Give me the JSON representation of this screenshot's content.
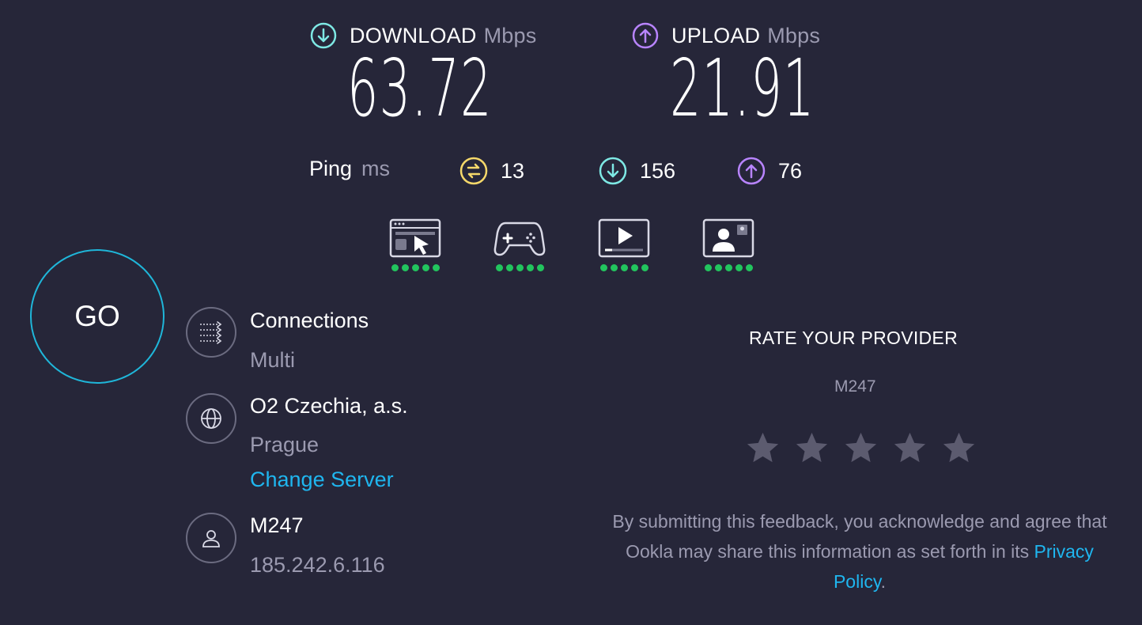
{
  "download": {
    "label": "DOWNLOAD",
    "unit": "Mbps",
    "value": "63.72",
    "icon": "download-arrow-icon",
    "color": "#7ee8e4"
  },
  "upload": {
    "label": "UPLOAD",
    "unit": "Mbps",
    "value": "21.91",
    "icon": "upload-arrow-icon",
    "color": "#b884ff"
  },
  "ping": {
    "label": "Ping",
    "unit": "ms",
    "idle": "13",
    "download": "156",
    "upload": "76",
    "idle_color": "#f5d86a"
  },
  "features": [
    {
      "name": "web-browsing",
      "icon": "browser-cursor-icon",
      "rating": 5
    },
    {
      "name": "gaming",
      "icon": "gamepad-icon",
      "rating": 5
    },
    {
      "name": "video-streaming",
      "icon": "video-play-icon",
      "rating": 5
    },
    {
      "name": "video-chat",
      "icon": "video-chat-icon",
      "rating": 5
    }
  ],
  "go_label": "GO",
  "connections": {
    "title": "Connections",
    "value": "Multi",
    "icon": "connections-arrows-icon"
  },
  "server": {
    "title": "O2 Czechia, a.s.",
    "location": "Prague",
    "change_label": "Change Server",
    "icon": "globe-icon"
  },
  "provider": {
    "title": "M247",
    "ip": "185.242.6.116",
    "icon": "user-icon"
  },
  "rate": {
    "title": "RATE YOUR PROVIDER",
    "provider": "M247",
    "stars": 5,
    "star_color": "#5c5b6f",
    "disclaimer_pre": "By submitting this feedback, you acknowledge and agree that Ookla may share this information as set forth in its ",
    "privacy_label": "Privacy Policy",
    "disclaimer_post": "."
  },
  "colors": {
    "background": "#262639",
    "accent": "#1fb6ef",
    "go_ring": "#1fb6d9",
    "dot_green": "#22c55e"
  }
}
